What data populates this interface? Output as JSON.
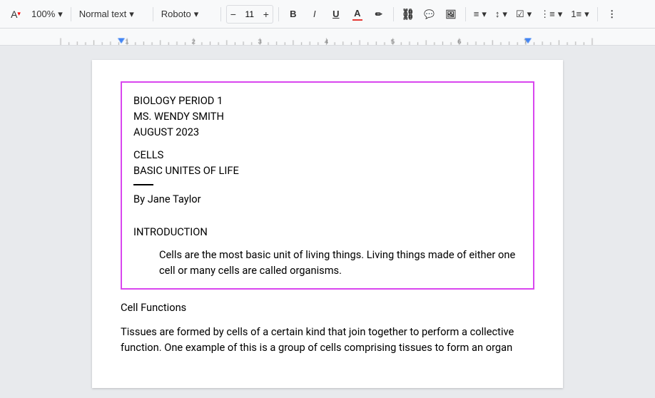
{
  "toolbar": {
    "spell_check_label": "A",
    "zoom_label": "100%",
    "zoom_dropdown_arrow": "▾",
    "style_label": "Normal text",
    "style_dropdown_arrow": "▾",
    "font_label": "Roboto",
    "font_dropdown_arrow": "▾",
    "font_size": "11",
    "decrease_font_label": "−",
    "increase_font_label": "+",
    "bold_label": "B",
    "italic_label": "I",
    "underline_label": "U",
    "font_color_label": "A",
    "highlight_label": "✏",
    "link_label": "🔗",
    "comment_label": "💬",
    "image_label": "🖼",
    "align_label": "≡",
    "align_arrow": "▾",
    "line_spacing_label": "↕",
    "line_spacing_arrow": "▾",
    "checklist_label": "☑",
    "checklist_arrow": "▾",
    "list_label": "≡",
    "list_arrow": "▾",
    "numbered_label": "≡",
    "numbered_arrow": "▾",
    "more_label": "⋮"
  },
  "ruler": {
    "numbers": [
      "1",
      "1",
      "2",
      "3",
      "4",
      "5",
      "6",
      "7"
    ]
  },
  "document": {
    "selected_block": {
      "line1": "BIOLOGY PERIOD 1",
      "line2": "MS. WENDY SMITH",
      "line3": "AUGUST 2023",
      "title1": "CELLS",
      "title2": "BASIC UNITES OF LIFE",
      "byline": "By Jane Taylor",
      "section": "INTRODUCTION",
      "para": "Cells are the most basic unit of living things. Living things made of either one cell or many cells are called organisms."
    },
    "cell_functions_title": "Cell Functions",
    "body_para": "Tissues are formed by cells of a certain kind that join together to perform a collective function. One example of this is a group of cells comprising tissues to form an organ"
  }
}
